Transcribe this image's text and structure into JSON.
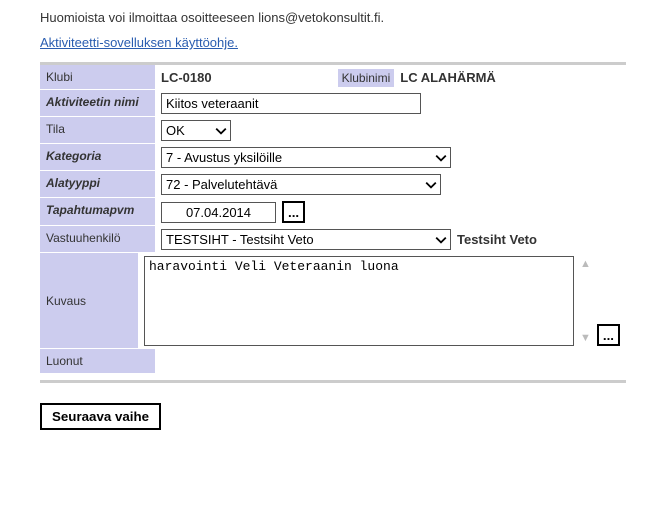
{
  "intro": "Huomioista voi ilmoittaa osoitteeseen lions@vetokonsultit.fi.",
  "doclink": "Aktiviteetti-sovelluksen käyttöohje.",
  "labels": {
    "klubi": "Klubi",
    "klubinimi": "Klubinimi",
    "aktiviteettinimi": "Aktiviteetin nimi",
    "tila": "Tila",
    "kategoria": "Kategoria",
    "alatyyppi": "Alatyyppi",
    "tapahtumapvm": "Tapahtumapvm",
    "vastuuhenkilo": "Vastuuhenkilö",
    "kuvaus": "Kuvaus",
    "luonut": "Luonut"
  },
  "values": {
    "klubi": "LC-0180",
    "klubinimi": "LC ALAHÄRMÄ",
    "aktiviteettinimi": "Kiitos veteraanit",
    "tila": "OK",
    "kategoria": "7 - Avustus yksilöille",
    "alatyyppi": "72 - Palvelutehtävä",
    "tapahtumapvm": "07.04.2014",
    "vastuuhenkilo": "TESTSIHT - Testsiht Veto",
    "vastuuhenkilo_name": "Testsiht Veto",
    "kuvaus": "haravointi Veli Veteraanin luona",
    "luonut": ""
  },
  "buttons": {
    "ellipsis": "...",
    "next": "Seuraava vaihe"
  }
}
